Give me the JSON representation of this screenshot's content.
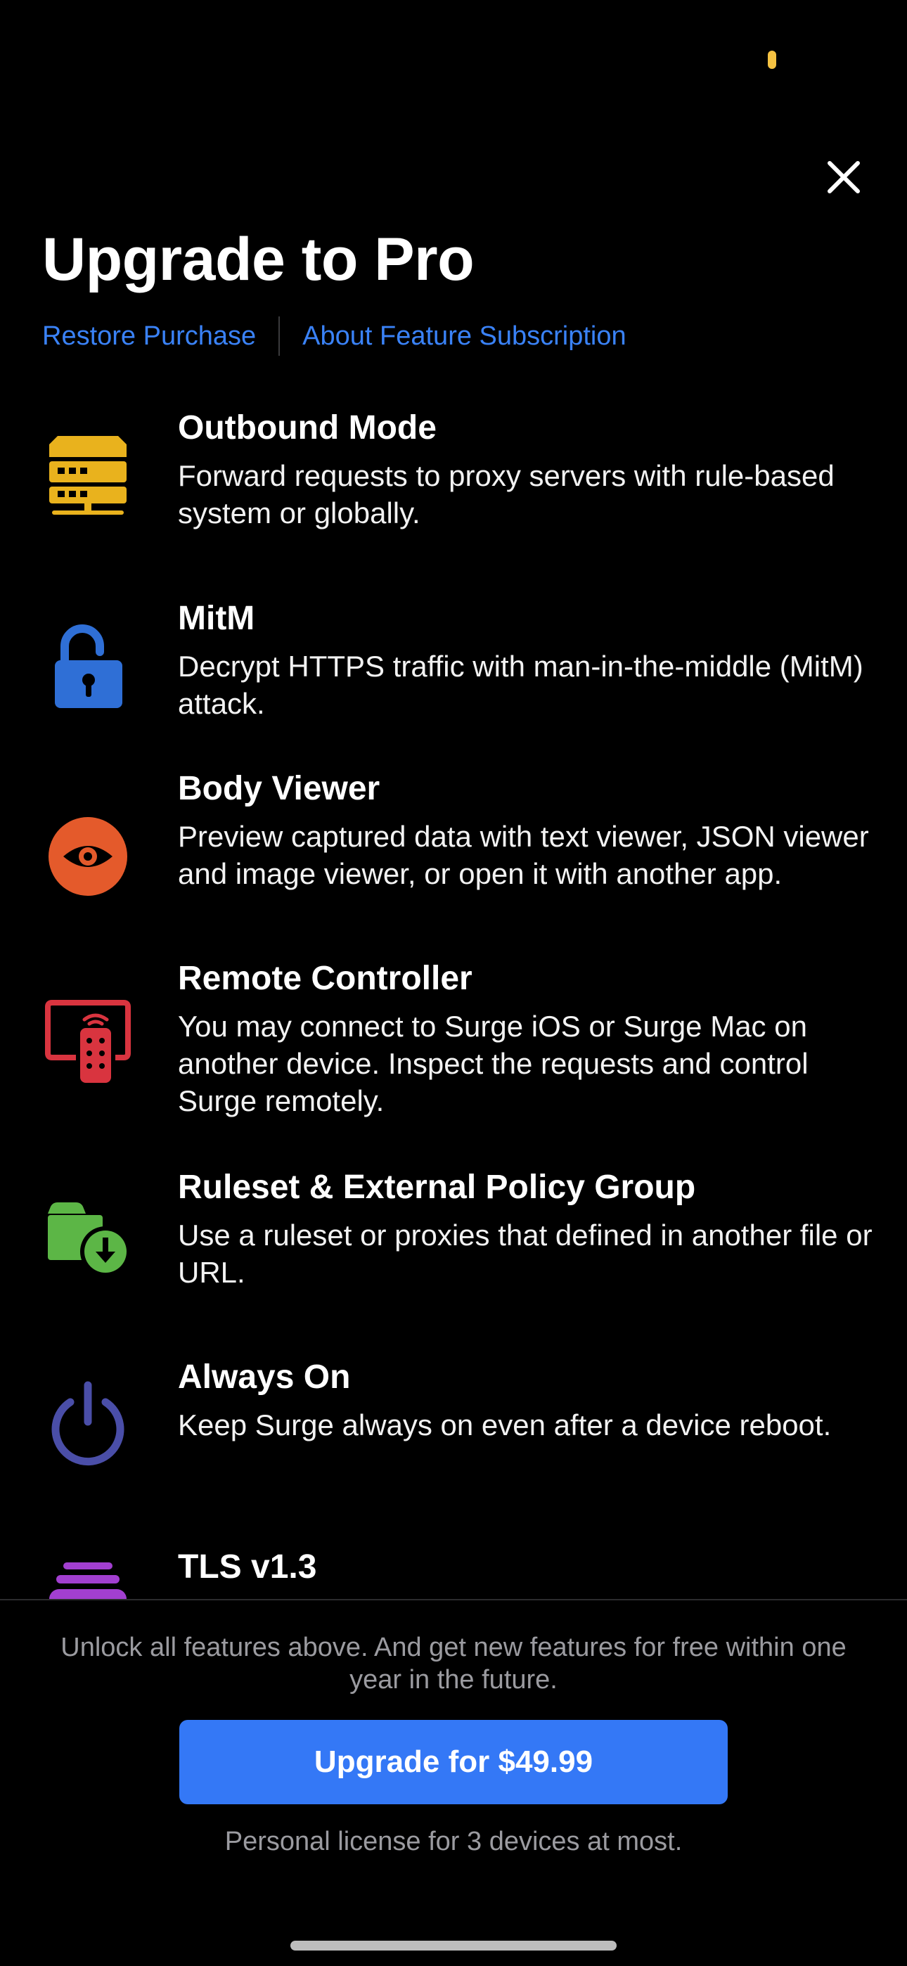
{
  "header": {
    "title": "Upgrade to Pro",
    "restore_label": "Restore Purchase",
    "about_label": "About Feature Subscription"
  },
  "features": [
    {
      "title": "Outbound Mode",
      "description": "Forward requests to proxy servers with rule-based system or globally.",
      "icon": "server-icon",
      "color": "#e9b21d"
    },
    {
      "title": "MitM",
      "description": "Decrypt HTTPS traffic with man-in-the-middle (MitM) attack.",
      "icon": "unlock-icon",
      "color": "#2f6fd6"
    },
    {
      "title": "Body Viewer",
      "description": "Preview captured data with text viewer, JSON viewer and image viewer, or open it with another app.",
      "icon": "eye-icon",
      "color": "#e45a2b"
    },
    {
      "title": "Remote Controller",
      "description": "You may connect to Surge iOS or Surge Mac on another device. Inspect the requests and control Surge remotely.",
      "icon": "remote-icon",
      "color": "#d9343f"
    },
    {
      "title": "Ruleset & External Policy Group",
      "description": "Use a ruleset or proxies that defined in another file or URL.",
      "icon": "download-box-icon",
      "color": "#5cb646"
    },
    {
      "title": "Always On",
      "description": "Keep Surge always on even after a device reboot.",
      "icon": "power-icon",
      "color": "#4a4ea8"
    },
    {
      "title": "TLS v1.3",
      "description": "",
      "icon": "layers-icon",
      "color": "#a23fd0"
    }
  ],
  "footer": {
    "unlock_text": "Unlock all features above. And get new features for free within one year in the future.",
    "upgrade_label": "Upgrade for $49.99",
    "license_text": "Personal license for 3 devices at most."
  },
  "colors": {
    "background": "#000000",
    "accent": "#3478f6",
    "link": "#3a82f7"
  }
}
